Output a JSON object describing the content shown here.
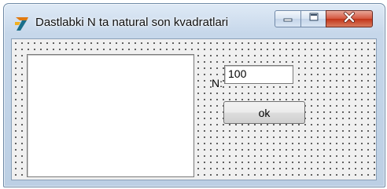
{
  "window": {
    "title": "Dastlabki N ta natural son kvadratlari"
  },
  "icons": {
    "app": "delphi-app-icon",
    "minimize": "minimize-icon",
    "maximize": "maximize-icon",
    "close": "close-icon"
  },
  "form": {
    "memo_lines": "",
    "n_label": "N:",
    "n_value": "100",
    "ok_label": "ok"
  },
  "colors": {
    "close_button": "#c23519",
    "title_bar": "#c6d7ea",
    "client_background": "#f0f0f0"
  }
}
